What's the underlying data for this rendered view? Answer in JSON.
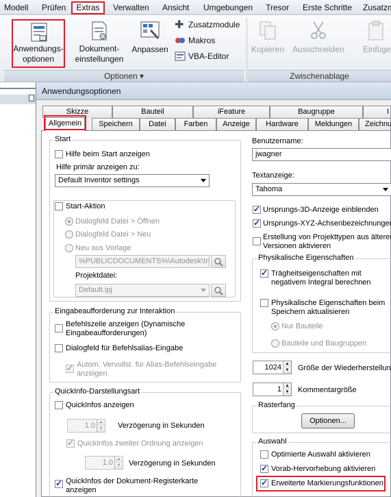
{
  "menu": {
    "items": [
      "Modell",
      "Prüfen",
      "Extras",
      "Verwalten",
      "Ansicht",
      "Umgebungen",
      "Tresor",
      "Erste Schritte",
      "Zusatzm"
    ],
    "active": "Extras"
  },
  "ribbon": {
    "anwendungsoptionen": "Anwendungs-\noptionen",
    "dokument": "Dokument-\neinstellungen",
    "anpassen": "Anpassen",
    "zusatzmodule": "Zusatzmodule",
    "makros": "Makros",
    "vba": "VBA-Editor",
    "kopieren": "Kopieren",
    "ausschneiden": "Ausschneiden",
    "einfuegen": "Einfüge",
    "panel_optionen": "Optionen ▾",
    "panel_zwischenablage": "Zwischenablage"
  },
  "dialog": {
    "title": "Anwendungsoptionen",
    "tabs_row1": [
      "Skizze",
      "Bauteil",
      "iFeature",
      "Baugruppe",
      "I"
    ],
    "tabs_row2": [
      "Allgemein",
      "Speichern",
      "Datei",
      "Farben",
      "Anzeige",
      "Hardware",
      "Meldungen",
      "Zeichnu"
    ]
  },
  "start": {
    "group_title": "Start",
    "hilfe_beim_start": "Hilfe beim Start anzeigen",
    "hilfe_primaer": "Hilfe primär anzeigen zu:",
    "hilfe_select": "Default Inventor settings",
    "start_aktion": "Start-Aktion",
    "radio1": "Dialogfeld Datei > Öffnen",
    "radio2": "Dialogfeld Datei > Neu",
    "radio3": "Neu aus Vorlage",
    "vorlage_path": "%PUBLICDOCUMENTS%\\Autodesk\\Inv",
    "projektdatei_label": "Projektdatei:",
    "projektdatei": "Default.ipj"
  },
  "eingabe": {
    "group_title": "Eingabeaufforderung zur Interaktion",
    "befehlszeile": "Befehlszeile anzeigen (Dynamische\nEingabeaufforderungen)",
    "dialogfeld_alias": "Dialogfeld für Befehlsalias-Eingabe",
    "autom": "Autom. Vervollst. für Alias-Befehlseingabe\nanzeigen"
  },
  "quickinfo": {
    "group_title": "QuickInfo-Darstellungsart",
    "quickinfos_anzeigen": "QuickInfos anzeigen",
    "delay1": "1.0",
    "verz1": "Verzögerung in Sekunden",
    "zweiter": "QuickInfos zweiter Ordnung anzeigen",
    "delay2": "1.0",
    "verz2": "Verzögerung in Sekunden",
    "dokument_registerkarte": "QuickInfos der Dokument-Registerkarte\nanzeigen"
  },
  "right": {
    "benutzername_label": "Benutzername:",
    "benutzername": "jwagner",
    "textanzeige_label": "Textanzeige:",
    "textanzeige": "Tahoma",
    "ursprung3d": "Ursprungs-3D-Anzeige einblenden",
    "ursprungxyz": "Ursprungs-XYZ-Achsenbezeichnungen a",
    "projekttypen": "Erstellung von Projekttypen aus älteren\nVersionen aktivieren",
    "phys_title": "Physikalische Eigenschaften",
    "traegheit": "Trägheitseigenschaften mit\nnegativem Integral berechnen",
    "phys_speichern": "Physikalische Eigenschaften beim\nSpeichern aktualisieren",
    "nur_bauteile": "Nur Bauteile",
    "bauteile_baugruppen": "Bauteile und Baugruppen",
    "wiederherstellung_val": "1024",
    "wiederherstellung": "Größe der Wiederherstellung",
    "kommentar_val": "1",
    "kommentar": "Kommentargröße",
    "rasterfang_title": "Rasterfang",
    "optionen_btn": "Optionen...",
    "auswahl_title": "Auswahl",
    "optimierte": "Optimierte Auswahl aktivieren",
    "vorab": "Vorab-Hervorhebung aktivieren",
    "erweiterte": "Erweiterte Markierungsfunktionen"
  },
  "colors": {
    "highlight": "#e01e2a",
    "check": "#1c2f8a"
  }
}
